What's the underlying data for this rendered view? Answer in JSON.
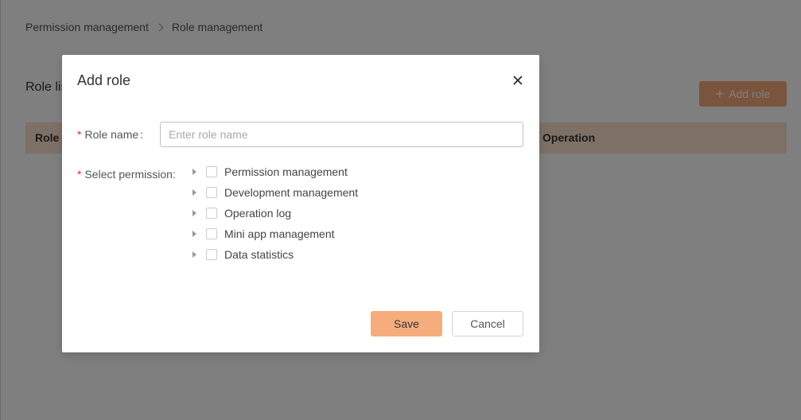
{
  "breadcrumb": {
    "items": [
      "Permission management",
      "Role management"
    ]
  },
  "page": {
    "section_title": "Role list",
    "add_role_label": "Add role",
    "table_headers": {
      "role": "Role",
      "operation": "Operation"
    }
  },
  "modal": {
    "title": "Add role",
    "role_name_label": "Role name",
    "role_name_colon": ":",
    "role_name_placeholder": "Enter role name",
    "role_name_value": "",
    "permission_label": "Select permission:",
    "permissions": [
      {
        "label": "Permission management",
        "checked": false,
        "expanded": false
      },
      {
        "label": "Development management",
        "checked": false,
        "expanded": false
      },
      {
        "label": "Operation log",
        "checked": false,
        "expanded": false
      },
      {
        "label": "Mini app management",
        "checked": false,
        "expanded": false
      },
      {
        "label": "Data statistics",
        "checked": false,
        "expanded": false
      }
    ],
    "save_label": "Save",
    "cancel_label": "Cancel"
  },
  "colors": {
    "accent": "#f5ad7d",
    "table_header_bg": "#fbe0cc",
    "required": "#f5222d",
    "overlay": "rgba(0,0,0,0.5)"
  },
  "icons": {
    "close": "close-icon",
    "add": "plus-icon",
    "tree_toggle": "caret-right-icon",
    "breadcrumb_sep": "chevron-right-icon"
  }
}
